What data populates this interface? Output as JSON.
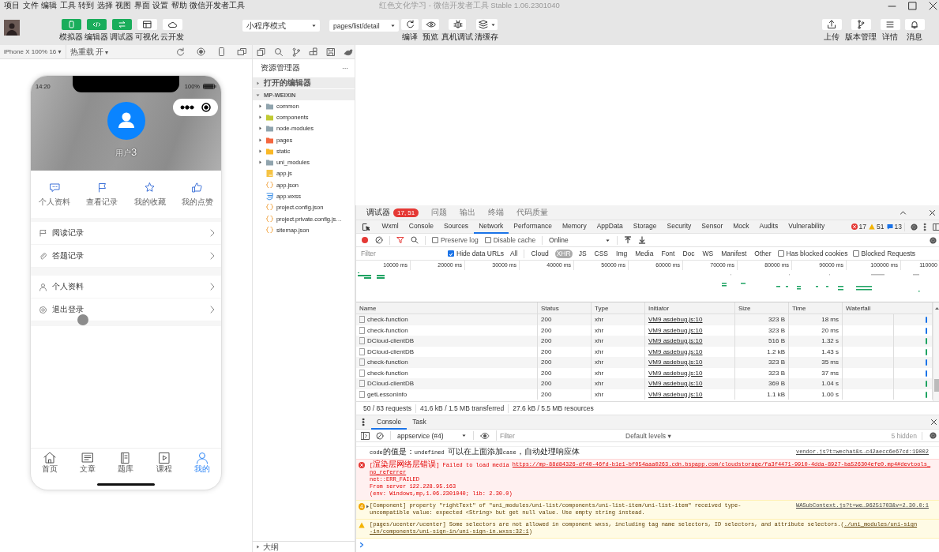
{
  "menu": [
    "项目",
    "文件",
    "编辑",
    "工具",
    "转到",
    "选择",
    "视图",
    "界面",
    "设置",
    "帮助",
    "微信开发者工具"
  ],
  "window": {
    "title": "红色文化学习 - 微信开发者工具 Stable 1.06.2301040"
  },
  "toolbar": {
    "modes": [
      {
        "label": "模拟器",
        "selected": true
      },
      {
        "label": "编辑器",
        "selected": true
      },
      {
        "label": "调试器",
        "selected": true
      },
      {
        "label": "可视化",
        "selected": false
      },
      {
        "label": "云开发",
        "selected": false
      }
    ],
    "mode_select": "小程序模式",
    "page_select": "pages/list/detail",
    "actions": [
      "编译",
      "预览",
      "真机调试",
      "清缓存"
    ],
    "right_actions": [
      "上传",
      "版本管理",
      "详情",
      "消息"
    ]
  },
  "simulator": {
    "device": "iPhone X 100% 16 ▾",
    "hot_reload": "热重载 开 ▾",
    "phone": {
      "time": "14:20",
      "battery": "100%",
      "user": "用户3",
      "shortcuts": [
        "个人资料",
        "查看记录",
        "我的收藏",
        "我的点赞"
      ],
      "groups": [
        [
          "阅读记录",
          "答题记录"
        ],
        [
          "个人资料",
          "退出登录"
        ]
      ],
      "tabs": [
        {
          "label": "首页",
          "selected": false
        },
        {
          "label": "文章",
          "selected": false
        },
        {
          "label": "题库",
          "selected": false
        },
        {
          "label": "课程",
          "selected": false
        },
        {
          "label": "我的",
          "selected": true
        }
      ]
    }
  },
  "file_tree": {
    "title": "资源管理器",
    "more": "···",
    "sections": [
      {
        "label": "打开的编辑器",
        "expanded": false
      },
      {
        "label": "MP-WEIXIN",
        "expanded": true
      }
    ],
    "items": [
      {
        "name": "common",
        "kind": "folder",
        "color": "#90a4ae"
      },
      {
        "name": "components",
        "kind": "folder",
        "color": "#c0ca33"
      },
      {
        "name": "node-modules",
        "kind": "folder",
        "color": "#90a4ae"
      },
      {
        "name": "pages",
        "kind": "folder",
        "color": "#f4673f"
      },
      {
        "name": "static",
        "kind": "folder",
        "color": "#f9b826"
      },
      {
        "name": "uni_modules",
        "kind": "folder",
        "color": "#90a4ae"
      },
      {
        "name": "app.js",
        "kind": "js"
      },
      {
        "name": "app.json",
        "kind": "json"
      },
      {
        "name": "app.wxss",
        "kind": "wxss"
      },
      {
        "name": "project.config.json",
        "kind": "json"
      },
      {
        "name": "project.private.config.js…",
        "kind": "json"
      },
      {
        "name": "sitemap.json",
        "kind": "json"
      }
    ],
    "outline": {
      "label": "大纲",
      "expanded": false
    }
  },
  "devtools": {
    "top_tabs": [
      {
        "label": "调试器",
        "selected": true,
        "badge": "17, 51"
      },
      {
        "label": "问题",
        "selected": false
      },
      {
        "label": "输出",
        "selected": false
      },
      {
        "label": "终端",
        "selected": false
      },
      {
        "label": "代码质量",
        "selected": false
      }
    ],
    "panel_tabs": [
      {
        "label": "Wxml",
        "selected": false
      },
      {
        "label": "Console",
        "selected": false
      },
      {
        "label": "Sources",
        "selected": false
      },
      {
        "label": "Network",
        "selected": true
      },
      {
        "label": "Performance",
        "selected": false
      },
      {
        "label": "Memory",
        "selected": false
      },
      {
        "label": "AppData",
        "selected": false
      },
      {
        "label": "Storage",
        "selected": false
      },
      {
        "label": "Security",
        "selected": false
      },
      {
        "label": "Sensor",
        "selected": false
      },
      {
        "label": "Mock",
        "selected": false
      },
      {
        "label": "Audits",
        "selected": false
      },
      {
        "label": "Vulnerability",
        "selected": false
      }
    ],
    "counts": {
      "errors": "17",
      "warnings": "51",
      "info": "13"
    },
    "network": {
      "recording": true,
      "preserve_log": false,
      "preserve_log_label": "Preserve log",
      "disable_cache": false,
      "disable_cache_label": "Disable cache",
      "throttling": "Online",
      "filter_placeholder": "Filter",
      "hide_data_urls": true,
      "hide_data_urls_label": "Hide data URLs",
      "types": [
        {
          "label": "All",
          "selected": false
        },
        {
          "label": "Cloud",
          "selected": false
        },
        {
          "label": "XHR",
          "selected": true
        },
        {
          "label": "JS",
          "selected": false
        },
        {
          "label": "CSS",
          "selected": false
        },
        {
          "label": "Img",
          "selected": false
        },
        {
          "label": "Media",
          "selected": false
        },
        {
          "label": "Font",
          "selected": false
        },
        {
          "label": "Doc",
          "selected": false
        },
        {
          "label": "WS",
          "selected": false
        },
        {
          "label": "Manifest",
          "selected": false
        },
        {
          "label": "Other",
          "selected": false
        }
      ],
      "has_blocked_cookies": false,
      "has_blocked_cookies_label": "Has blocked cookies",
      "blocked_requests": false,
      "blocked_requests_label": "Blocked Requests",
      "overview_ticks": [
        "10000 ms",
        "20000 ms",
        "30000 ms",
        "40000 ms",
        "50000 ms",
        "60000 ms",
        "70000 ms",
        "80000 ms",
        "90000 ms",
        "100000 ms",
        "110000"
      ],
      "columns": [
        "Name",
        "Status",
        "Type",
        "Initiator",
        "Size",
        "Time",
        "Waterfall"
      ],
      "rows": [
        {
          "name": "check-function",
          "status": "200",
          "type": "xhr",
          "initiator": "VM9 asdebug.js:10",
          "size": "323 B",
          "time": "18 ms",
          "color": "#1a73e8"
        },
        {
          "name": "check-function",
          "status": "200",
          "type": "xhr",
          "initiator": "VM9 asdebug.js:10",
          "size": "323 B",
          "time": "20 ms",
          "color": "#1a73e8"
        },
        {
          "name": "DCloud-clientDB",
          "status": "200",
          "type": "xhr",
          "initiator": "VM9 asdebug.js:10",
          "size": "516 B",
          "time": "1.32 s",
          "color": "#1ea362"
        },
        {
          "name": "DCloud-clientDB",
          "status": "200",
          "type": "xhr",
          "initiator": "VM9 asdebug.js:10",
          "size": "1.2 kB",
          "time": "1.43 s",
          "color": "#1ea362"
        },
        {
          "name": "check-function",
          "status": "200",
          "type": "xhr",
          "initiator": "VM9 asdebug.js:10",
          "size": "323 B",
          "time": "35 ms",
          "color": "#1a73e8"
        },
        {
          "name": "check-function",
          "status": "200",
          "type": "xhr",
          "initiator": "VM9 asdebug.js:10",
          "size": "323 B",
          "time": "37 ms",
          "color": "#1a73e8"
        },
        {
          "name": "DCloud-clientDB",
          "status": "200",
          "type": "xhr",
          "initiator": "VM9 asdebug.js:10",
          "size": "369 B",
          "time": "1.04 s",
          "color": "#1ea362"
        },
        {
          "name": "getLessonInfo",
          "status": "200",
          "type": "xhr",
          "initiator": "VM9 asdebug.js:10",
          "size": "1.1 kB",
          "time": "1.00 s",
          "color": "#1ea362"
        }
      ],
      "summary": [
        "50 / 83 requests",
        "41.6 kB / 1.5 MB transferred",
        "27.6 kB / 5.5 MB resources"
      ]
    },
    "drawer": {
      "tabs": [
        {
          "label": "Console",
          "selected": true
        },
        {
          "label": "Task",
          "selected": false
        }
      ],
      "context": "appservice (#4)",
      "filter_placeholder": "Filter",
      "levels": "Default levels ▾",
      "hidden": "5 hidden",
      "messages": [
        {
          "kind": "log",
          "source": "vendor.js?t=wechat&s…c42aecc6e67cd:19002",
          "lines": [
            [
              {
                "kind": "text",
                "text": "code的值是：undefined 可以在上面添加case，自动处理响应体"
              }
            ]
          ]
        },
        {
          "kind": "error",
          "lines": [
            [
              {
                "kind": "text",
                "text": "[渲染层网络层错误] Failed to load media "
              },
              {
                "kind": "link",
                "text": "https://mp-88d84326-df40-46fd-b1e1-bf054aaa0263.cdn.bspapp.com/cloudstorage/fa3f4471-9910-4dda-8927-ba526304efe0.mp4#devtools_"
              }
            ],
            [
              {
                "kind": "link",
                "text": "no_referrer"
              }
            ],
            [
              {
                "kind": "text",
                "text": "net::ERR_FAILED"
              }
            ],
            [
              {
                "kind": "text",
                "text": "From server 122.228.95.163"
              }
            ],
            [
              {
                "kind": "text",
                "text": "(env: Windows,mp,1.06.2301040; lib: 2.30.0)"
              }
            ]
          ]
        },
        {
          "kind": "warning",
          "count": "4",
          "source": "WASubContext.js?t=we…96251703&v=2.30.0:1",
          "lines": [
            [
              {
                "kind": "text",
                "text": "[Component] property \"rightText\" of \"uni_modules/uni-list/components/uni-list-item/uni-list-item\" received type-"
              }
            ],
            [
              {
                "kind": "text",
                "text": "uncompatible value: expected <String> but get null value. Use empty string instead."
              }
            ]
          ]
        },
        {
          "kind": "warning",
          "lines": [
            [
              {
                "kind": "text",
                "text": "[pages/ucenter/ucenter] Some selectors are not allowed in component wxss, including tag name selectors, ID selectors, and attribute selectors.("
              },
              {
                "kind": "link",
                "text": "./uni_modules/uni-sign"
              }
            ],
            [
              {
                "kind": "link",
                "text": "-in/components/uni-sign-in/uni-sign-in.wxss:32:1"
              },
              {
                "kind": "text",
                "text": ")"
              }
            ]
          ]
        }
      ]
    }
  }
}
